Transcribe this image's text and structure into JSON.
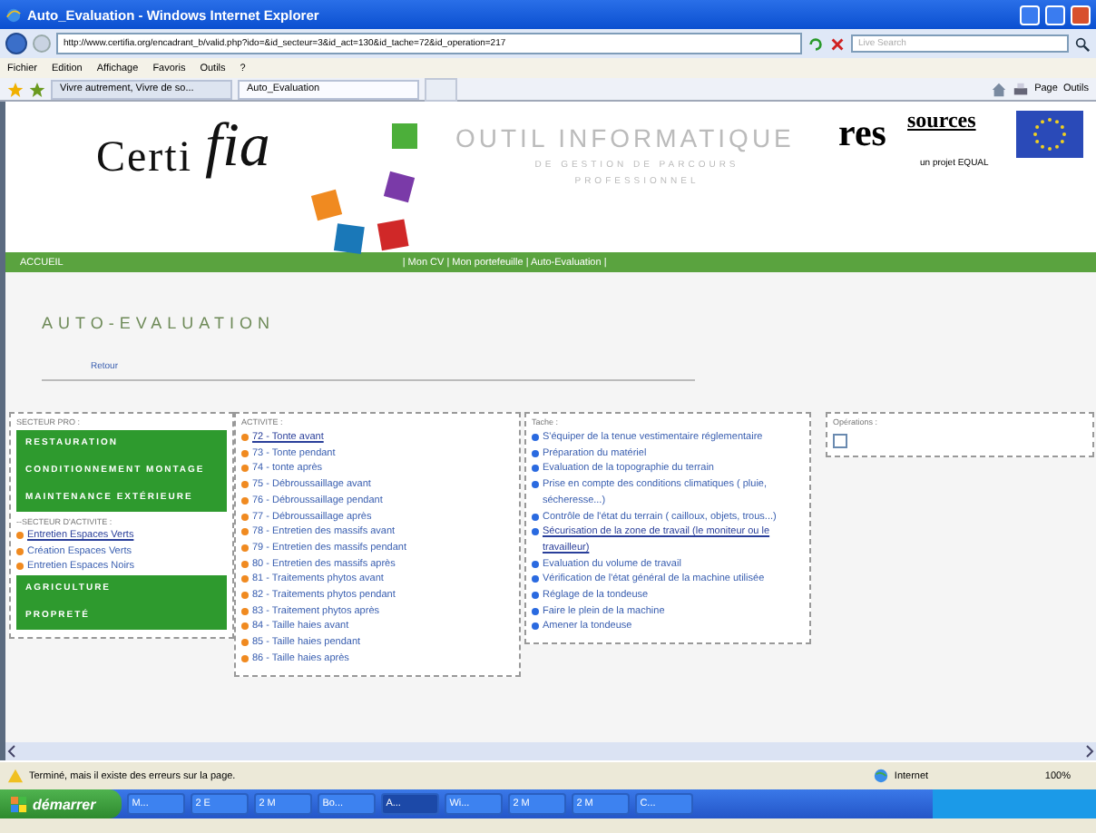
{
  "window": {
    "title": "Auto_Evaluation - Windows Internet Explorer"
  },
  "address_bar": {
    "url": "http://www.certifia.org/encadrant_b/valid.php?ido=&id_secteur=3&id_act=130&id_tache=72&id_operation=217",
    "search_placeholder": "Live Search"
  },
  "menu": [
    "Fichier",
    "Edition",
    "Affichage",
    "Favoris",
    "Outils",
    "?"
  ],
  "tabs": [
    {
      "label": "Vivre autrement, Vivre de so...",
      "selected": false
    },
    {
      "label": "Auto_Evaluation",
      "selected": true
    }
  ],
  "command_bar": [
    "Page",
    "Outils"
  ],
  "header": {
    "logo": "Certi",
    "logo_script": "fia",
    "headline": "OUTIL INFORMATIQUE",
    "subline": "DE GESTION DE PARCOURS PROFESSIONNEL",
    "partner_logo": "res",
    "partner_logo_raised": "sources",
    "partner_tagline": "un projet EQUAL"
  },
  "nav": {
    "home": "ACCUEIL",
    "links": "| Mon CV | Mon portefeuille | Auto-Evaluation |"
  },
  "page_title": "AUTO-EVALUATION",
  "back_link": "Retour",
  "sector_panel": {
    "label": "SECTEUR PRO :",
    "items": [
      {
        "kind": "sector",
        "label": "RESTAURATION"
      },
      {
        "kind": "sector",
        "label": "CONDITIONNEMENT MONTAGE"
      },
      {
        "kind": "sector",
        "label": "MAINTENANCE EXTÉRIEURE"
      },
      {
        "kind": "heading",
        "label": "--SECTEUR D'ACTIVITE :"
      },
      {
        "kind": "domain",
        "label": "Entretien Espaces Verts",
        "selected": true
      },
      {
        "kind": "domain",
        "label": "Création Espaces Verts",
        "selected": false
      },
      {
        "kind": "domain",
        "label": "Entretien Espaces Noirs",
        "selected": false
      },
      {
        "kind": "sector",
        "label": "AGRICULTURE"
      },
      {
        "kind": "sector",
        "label": "PROPRETÉ"
      }
    ]
  },
  "activity_panel": {
    "label": "ACTIVITE :",
    "items": [
      {
        "label": "72 - Tonte avant",
        "selected": true
      },
      {
        "label": "73 - Tonte pendant",
        "selected": false
      },
      {
        "label": "74 - tonte après",
        "selected": false
      },
      {
        "label": "75 - Débroussaillage avant",
        "selected": false
      },
      {
        "label": "76 - Débroussaillage pendant",
        "selected": false
      },
      {
        "label": "77 - Débroussaillage après",
        "selected": false
      },
      {
        "label": "78 - Entretien des massifs avant",
        "selected": false
      },
      {
        "label": "79 - Entretien des massifs pendant",
        "selected": false
      },
      {
        "label": "80 - Entretien des massifs après",
        "selected": false
      },
      {
        "label": "81 - Traitements phytos avant",
        "selected": false
      },
      {
        "label": "82 - Traitements phytos pendant",
        "selected": false
      },
      {
        "label": "83 - Traitement phytos après",
        "selected": false
      },
      {
        "label": "84 - Taille haies avant",
        "selected": false
      },
      {
        "label": "85 - Taille haies pendant",
        "selected": false
      },
      {
        "label": "86 - Taille haies après",
        "selected": false
      }
    ]
  },
  "task_panel": {
    "label": "Tache :",
    "items": [
      {
        "label": "S'équiper de la tenue vestimentaire réglementaire",
        "selected": false
      },
      {
        "label": "Préparation du matériel",
        "selected": false
      },
      {
        "label": "Evaluation de la topographie du terrain",
        "selected": false
      },
      {
        "label": "Prise en compte des conditions climatiques ( pluie, sécheresse...)",
        "selected": false
      },
      {
        "label": "Contrôle de l'état du terrain ( cailloux, objets, trous...)",
        "selected": false
      },
      {
        "label": "Sécurisation de la zone de travail (le moniteur ou le travailleur)",
        "selected": true
      },
      {
        "label": "Evaluation du volume de travail",
        "selected": false
      },
      {
        "label": "Vérification de l'état général de la machine utilisée",
        "selected": false
      },
      {
        "label": "Réglage de la tondeuse",
        "selected": false
      },
      {
        "label": "Faire le plein de la machine",
        "selected": false
      },
      {
        "label": "Amener la tondeuse",
        "selected": false
      }
    ]
  },
  "operations_panel": {
    "label": "Opérations :",
    "checkboxes": [
      {
        "checked": false
      }
    ]
  },
  "status_bar": {
    "message": "Terminé, mais il existe des erreurs sur la page.",
    "zone": "Internet",
    "zoom": "100%"
  },
  "taskbar": {
    "start": "démarrer",
    "items": [
      {
        "label": "M...",
        "selected": false
      },
      {
        "label": "2 E",
        "selected": false
      },
      {
        "label": "2 M",
        "selected": false
      },
      {
        "label": "Bo...",
        "selected": false
      },
      {
        "label": "A...",
        "selected": true
      },
      {
        "label": "Wi...",
        "selected": false
      },
      {
        "label": "2 M",
        "selected": false
      },
      {
        "label": "2 M",
        "selected": false
      },
      {
        "label": "C...",
        "selected": false
      }
    ]
  }
}
